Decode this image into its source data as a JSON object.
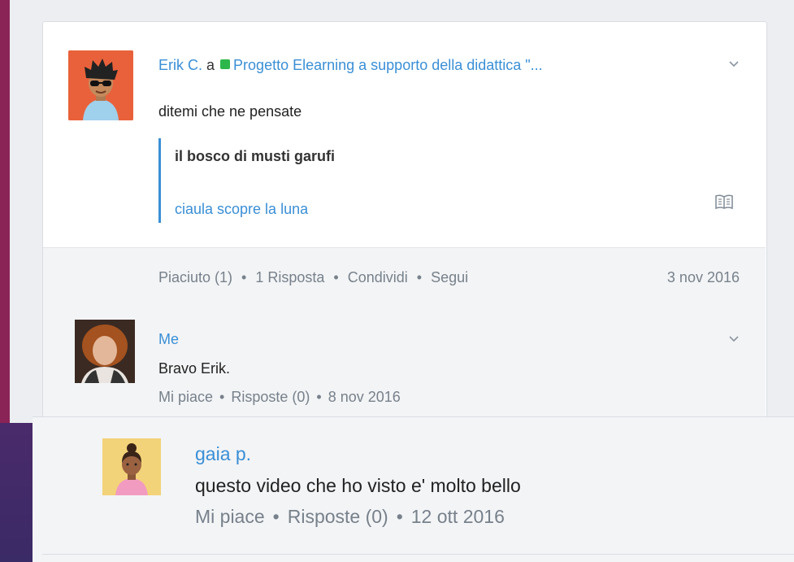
{
  "post": {
    "author": "Erik C.",
    "connector": "a",
    "group": "Progetto Elearning a supporto della didattica \"...",
    "text": "ditemi che ne pensate",
    "quote": {
      "title": "il bosco di musti garufi",
      "subtitle": "ciaula scopre la luna"
    },
    "actions": {
      "like": "Piaciuto (1)",
      "reply": "1 Risposta",
      "share": "Condividi",
      "follow": "Segui",
      "separator": "•"
    },
    "date": "3 nov 2016"
  },
  "replies": [
    {
      "author": "Me",
      "text": "Bravo Erik.",
      "like": "Mi piace",
      "replies": "Risposte (0)",
      "date": "8 nov 2016",
      "separator": "•"
    },
    {
      "author": "gaia p.",
      "text": "questo video che ho visto e' molto bello",
      "like": "Mi piace",
      "replies": "Risposte (0)",
      "date": "12 ott 2016",
      "separator": "•"
    }
  ],
  "icons": {
    "expand": "chevron-down-icon",
    "book": "book-icon",
    "group": "group-status-icon"
  },
  "colors": {
    "accent": "#3a8fd6",
    "group_dot": "#2db74a",
    "muted": "#77818b"
  }
}
